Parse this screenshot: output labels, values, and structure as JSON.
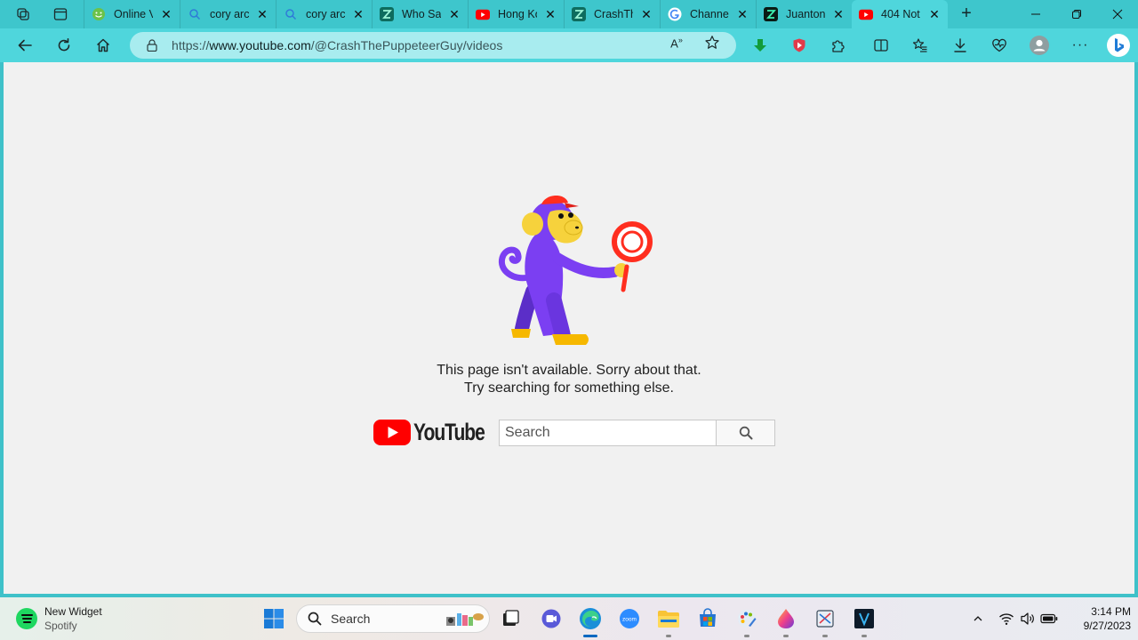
{
  "browser": {
    "tabs": [
      {
        "title": "Online V",
        "icon": "smiley-icon",
        "color": "#6cc24a"
      },
      {
        "title": "cory arc",
        "icon": "search-icon",
        "color": "#2f7bd8"
      },
      {
        "title": "cory arc",
        "icon": "search-icon",
        "color": "#2f7bd8"
      },
      {
        "title": "Who Say",
        "icon": "z-logo-icon",
        "color": "#0e6c5e"
      },
      {
        "title": "Hong Ko",
        "icon": "youtube-icon",
        "color": "#ff0000"
      },
      {
        "title": "CrashTh",
        "icon": "z-logo-icon",
        "color": "#0e6c5e"
      },
      {
        "title": "Channel",
        "icon": "google-icon",
        "color": "#4285f4"
      },
      {
        "title": "Juanton",
        "icon": "z-logo-icon",
        "color": "#0a1a14"
      },
      {
        "title": "404 Not",
        "icon": "youtube-icon",
        "color": "#ff0000",
        "active": true
      }
    ],
    "url_prefix": "https://",
    "url_host": "www.youtube.com",
    "url_path": "/@CrashThePuppeteerGuy/videos"
  },
  "page": {
    "message_line1": "This page isn't available. Sorry about that.",
    "message_line2": "Try searching for something else.",
    "logo_text": "YouTube",
    "search_placeholder": "Search"
  },
  "taskbar": {
    "widget_title": "New Widget",
    "widget_subtitle": "Spotify",
    "search_label": "Search",
    "time": "3:14 PM",
    "date": "9/27/2023",
    "zoom_label": "zoom"
  },
  "colors": {
    "accent": "#3ec6cc",
    "youtube_red": "#ff0000",
    "page_bg": "#f1f1f1"
  }
}
